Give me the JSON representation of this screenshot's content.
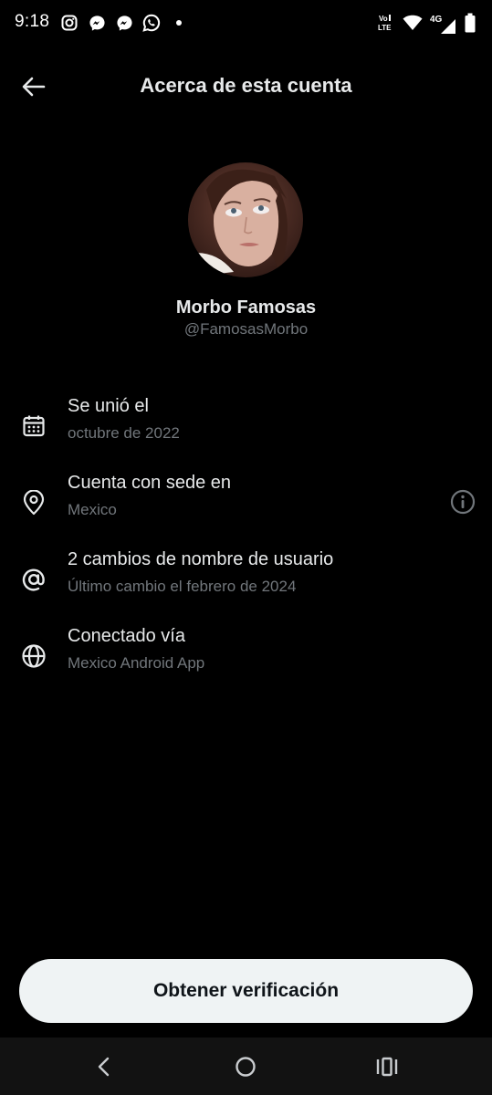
{
  "status_bar": {
    "time": "9:18",
    "left_icons": [
      "instagram-icon",
      "messenger-icon",
      "messenger-icon",
      "whatsapp-icon",
      "dot-icon"
    ],
    "right_icons": [
      "volte-icon",
      "wifi-icon",
      "signal-4g-icon",
      "battery-icon"
    ],
    "network_label": "4G"
  },
  "header": {
    "title": "Acerca de esta cuenta",
    "back_icon": "arrow-left-icon"
  },
  "profile": {
    "display_name": "Morbo Famosas",
    "handle": "@FamosasMorbo"
  },
  "info_rows": [
    {
      "icon": "calendar-icon",
      "title": "Se unió el",
      "subtitle": "octubre de 2022"
    },
    {
      "icon": "location-pin-icon",
      "title": "Cuenta con sede en",
      "subtitle": "Mexico",
      "trailing_icon": "info-icon"
    },
    {
      "icon": "at-sign-icon",
      "title": "2 cambios de nombre de usuario",
      "subtitle": "Último cambio el febrero de 2024"
    },
    {
      "icon": "globe-icon",
      "title": "Conectado vía",
      "subtitle": "Mexico Android App"
    }
  ],
  "cta": {
    "label": "Obtener verificación"
  },
  "nav_bar": {
    "buttons": [
      "back-nav-icon",
      "home-nav-icon",
      "recents-nav-icon"
    ]
  },
  "colors": {
    "background": "#000000",
    "primary_text": "#e7e9ea",
    "secondary_text": "#71767b",
    "button_bg": "#eff3f4",
    "button_text": "#0f1419",
    "nav_bar_bg": "#121212"
  }
}
